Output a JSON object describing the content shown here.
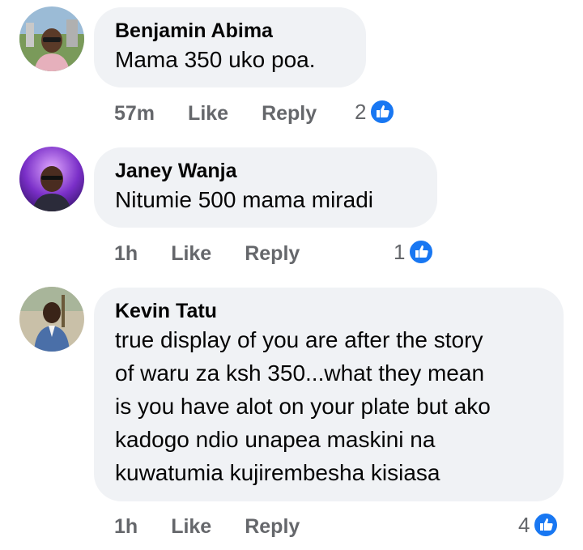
{
  "comments": [
    {
      "author": "Benjamin Abima",
      "text": "Mama 350 uko poa.",
      "time": "57m",
      "like_label": "Like",
      "reply_label": "Reply",
      "reaction_count": "2",
      "reaction_icon": "thumbs-up-icon"
    },
    {
      "author": "Janey Wanja",
      "text": "Nitumie 500 mama miradi",
      "time": "1h",
      "like_label": "Like",
      "reply_label": "Reply",
      "reaction_count": "1",
      "reaction_icon": "thumbs-up-icon"
    },
    {
      "author": "Kevin Tatu",
      "text_lines": [
        "true display of you are after the story",
        "of waru za ksh 350...what they mean",
        "is you have alot on your plate but ako",
        "kadogo ndio unapea maskini na",
        "kuwatumia kujirembesha kisiasa"
      ],
      "time": "1h",
      "like_label": "Like",
      "reply_label": "Reply",
      "reaction_count": "4",
      "reaction_icon": "thumbs-up-icon"
    }
  ],
  "colors": {
    "bubble": "#f0f2f5",
    "meta_text": "#65676b",
    "like_blue": "#1877f2"
  }
}
